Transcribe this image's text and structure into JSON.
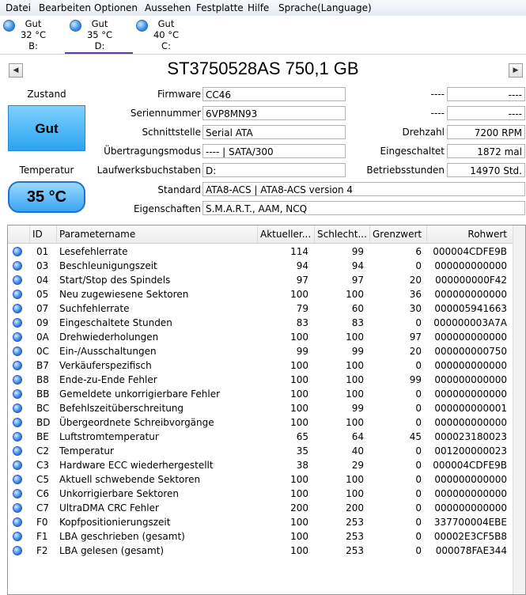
{
  "menu": [
    "Datei",
    "Bearbeiten",
    "Optionen",
    "Aussehen",
    "Festplatte",
    "Hilfe",
    "Sprache(Language)"
  ],
  "disks": [
    {
      "status": "Gut",
      "temp": "32 °C",
      "letter": "B:"
    },
    {
      "status": "Gut",
      "temp": "35 °C",
      "letter": "D:"
    },
    {
      "status": "Gut",
      "temp": "40 °C",
      "letter": "C:"
    }
  ],
  "drive": {
    "title": "ST3750528AS 750,1 GB",
    "zustand_label": "Zustand",
    "status": "Gut",
    "temperature_label": "Temperatur",
    "temperature": "35 °C",
    "info_left": [
      {
        "label": "Firmware",
        "value": "CC46"
      },
      {
        "label": "Seriennummer",
        "value": "6VP8MN93"
      },
      {
        "label": "Schnittstelle",
        "value": "Serial ATA"
      },
      {
        "label": "Übertragungsmodus",
        "value": "---- | SATA/300"
      },
      {
        "label": "Laufwerksbuchstaben",
        "value": "D:"
      }
    ],
    "info_right": [
      {
        "label": "----",
        "value": "----"
      },
      {
        "label": "----",
        "value": "----"
      },
      {
        "label": "Drehzahl",
        "value": "7200 RPM"
      },
      {
        "label": "Eingeschaltet",
        "value": "1872 mal"
      },
      {
        "label": "Betriebsstunden",
        "value": "14970 Std."
      }
    ],
    "standard_label": "Standard",
    "standard": "ATA8-ACS | ATA8-ACS version 4",
    "features_label": "Eigenschaften",
    "features": "S.M.A.R.T., AAM, NCQ"
  },
  "table": {
    "headers": [
      "ID",
      "Parametername",
      "Aktueller...",
      "Schlecht...",
      "Grenzwert",
      "Rohwert"
    ],
    "rows": [
      [
        "01",
        "Lesefehlerrate",
        "114",
        "99",
        "6",
        "000004CDFE9B"
      ],
      [
        "03",
        "Beschleunigungszeit",
        "94",
        "94",
        "0",
        "000000000000"
      ],
      [
        "04",
        "Start/Stop des Spindels",
        "97",
        "97",
        "20",
        "000000000F42"
      ],
      [
        "05",
        "Neu zugewiesene Sektoren",
        "100",
        "100",
        "36",
        "000000000000"
      ],
      [
        "07",
        "Suchfehlerrate",
        "79",
        "60",
        "30",
        "000005941663"
      ],
      [
        "09",
        "Eingeschaltete Stunden",
        "83",
        "83",
        "0",
        "000000003A7A"
      ],
      [
        "0A",
        "Drehwiederholungen",
        "100",
        "100",
        "97",
        "000000000000"
      ],
      [
        "0C",
        "Ein-/Ausschaltungen",
        "99",
        "99",
        "20",
        "000000000750"
      ],
      [
        "B7",
        "Verkäuferspezifisch",
        "100",
        "100",
        "0",
        "000000000000"
      ],
      [
        "B8",
        "Ende-zu-Ende Fehler",
        "100",
        "100",
        "99",
        "000000000000"
      ],
      [
        "BB",
        "Gemeldete unkorrigierbare Fehler",
        "100",
        "100",
        "0",
        "000000000000"
      ],
      [
        "BC",
        "Befehlszeitüberschreitung",
        "100",
        "99",
        "0",
        "000000000001"
      ],
      [
        "BD",
        "Übergeordnete Schreibvorgänge",
        "100",
        "100",
        "0",
        "000000000000"
      ],
      [
        "BE",
        "Luftstromtemperatur",
        "65",
        "64",
        "45",
        "000023180023"
      ],
      [
        "C2",
        "Temperatur",
        "35",
        "40",
        "0",
        "001200000023"
      ],
      [
        "C3",
        "Hardware ECC wiederhergestellt",
        "38",
        "29",
        "0",
        "000004CDFE9B"
      ],
      [
        "C5",
        "Aktuell schwebende Sektoren",
        "100",
        "100",
        "0",
        "000000000000"
      ],
      [
        "C6",
        "Unkorrigierbare Sektoren",
        "100",
        "100",
        "0",
        "000000000000"
      ],
      [
        "C7",
        "UltraDMA CRC Fehler",
        "200",
        "200",
        "0",
        "000000000000"
      ],
      [
        "F0",
        "Kopfpositionierungszeit",
        "100",
        "253",
        "0",
        "337700004EBE"
      ],
      [
        "F1",
        "LBA geschrieben (gesamt)",
        "100",
        "253",
        "0",
        "00002E3CF5B8"
      ],
      [
        "F2",
        "LBA gelesen (gesamt)",
        "100",
        "253",
        "0",
        "000078FAE344"
      ]
    ]
  }
}
